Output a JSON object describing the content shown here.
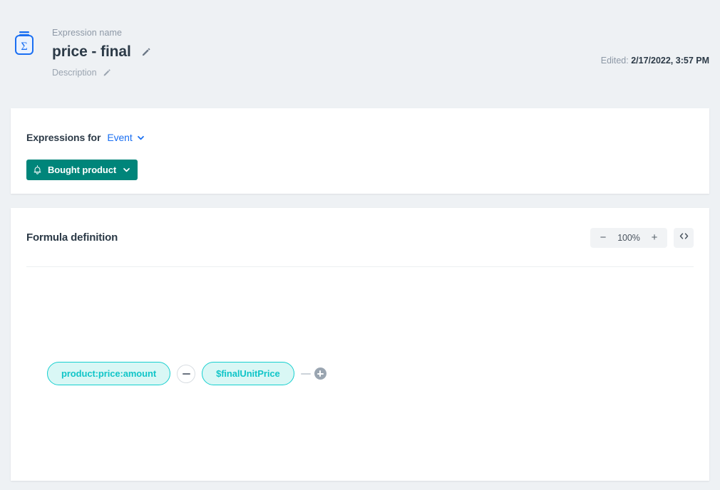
{
  "header": {
    "icon_name": "sigma-expression-icon",
    "name_label": "Expression name",
    "title": "price - final",
    "title_edit_icon": "pencil-icon",
    "description_label": "Description",
    "description_edit_icon": "pencil-icon",
    "edited_prefix": "Edited:",
    "edited_value": "2/17/2022, 3:57 PM"
  },
  "expressions_panel": {
    "label": "Expressions for",
    "scope_value": "Event",
    "scope_chevron": "chevron-down-icon",
    "badge": {
      "icon": "bell-icon",
      "label": "Bought product",
      "chevron": "chevron-down-icon"
    }
  },
  "formula_panel": {
    "title": "Formula definition",
    "zoom": {
      "decrease_label": "−",
      "level": "100%",
      "increase_label": "+",
      "code_icon": "code-brackets-icon"
    },
    "nodes": [
      {
        "label": "product:price:amount",
        "type": "attribute"
      },
      {
        "label": "$finalUnitPrice",
        "type": "variable"
      }
    ],
    "operator": {
      "symbol": "−",
      "name": "minus-operator"
    },
    "add_button": {
      "name": "add-node-button",
      "label": "+"
    }
  },
  "colors": {
    "page_bg": "#eef1f4",
    "card_bg": "#ffffff",
    "accent_blue": "#1a6ff2",
    "badge_teal": "#00857a",
    "node_border": "#16cfcf",
    "node_fill": "#d9f7f5",
    "node_text": "#11c5c8",
    "text_dark": "#2c3a47",
    "text_muted": "#8d98a6"
  }
}
